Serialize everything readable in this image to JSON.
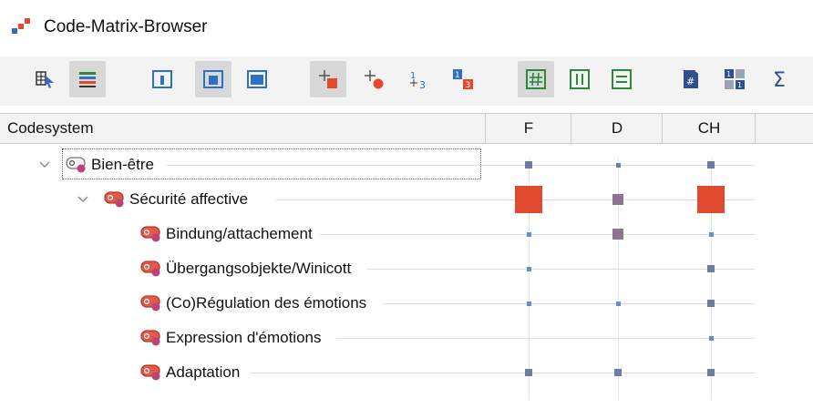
{
  "window": {
    "title": "Code-Matrix-Browser"
  },
  "toolbar": {
    "buttons": [
      {
        "icon": "select-matrix-icon",
        "active": false
      },
      {
        "icon": "colored-bars-icon",
        "active": true
      },
      {
        "icon": "layout-small-icon",
        "active": false
      },
      {
        "icon": "layout-medium-icon",
        "active": true
      },
      {
        "icon": "layout-large-icon",
        "active": false
      },
      {
        "icon": "symbol-square-icon",
        "active": true
      },
      {
        "icon": "symbol-circle-icon",
        "active": false
      },
      {
        "icon": "numbers-icon",
        "active": false
      },
      {
        "icon": "numbers-colored-icon",
        "active": false
      },
      {
        "icon": "grid-hash-icon",
        "active": true
      },
      {
        "icon": "columns-icon",
        "active": false
      },
      {
        "icon": "rows-icon",
        "active": false
      },
      {
        "icon": "document-hash-icon",
        "active": false
      },
      {
        "icon": "stats-icon",
        "active": false
      },
      {
        "icon": "sigma-icon",
        "active": false
      }
    ]
  },
  "table": {
    "header": {
      "codesystem": "Codesystem",
      "columns": [
        "F",
        "D",
        "CH"
      ]
    },
    "rows": [
      {
        "label": "Bien-être",
        "level": 0,
        "expanded": true,
        "focused": true,
        "cells": [
          {
            "size": "small",
            "color": "#6b7fa6"
          },
          {
            "size": "tiny",
            "color": "#6b7fa6"
          },
          {
            "size": "small",
            "color": "#6b7fa6"
          }
        ]
      },
      {
        "label": "Sécurité affective",
        "level": 1,
        "expanded": true,
        "focused": false,
        "cells": [
          {
            "size": "large",
            "color": "#e04a2f"
          },
          {
            "size": "medium",
            "color": "#8e7391"
          },
          {
            "size": "large",
            "color": "#e04a2f"
          }
        ]
      },
      {
        "label": "Bindung/attachement",
        "level": 2,
        "expanded": null,
        "focused": false,
        "cells": [
          {
            "size": "tiny",
            "color": "#5b8fd4"
          },
          {
            "size": "medium",
            "color": "#8e7391"
          },
          {
            "size": "tiny",
            "color": "#5b8fd4"
          }
        ]
      },
      {
        "label": "Übergangsobjekte/Winicott",
        "level": 2,
        "expanded": null,
        "focused": false,
        "cells": [
          {
            "size": "tiny",
            "color": "#5b8fd4"
          },
          null,
          {
            "size": "small",
            "color": "#6b7fa6"
          }
        ]
      },
      {
        "label": "(Co)Régulation des émotions",
        "level": 2,
        "expanded": null,
        "focused": false,
        "cells": [
          {
            "size": "tiny",
            "color": "#5b8fd4"
          },
          {
            "size": "tiny",
            "color": "#5b8fd4"
          },
          {
            "size": "small",
            "color": "#6b7fa6"
          }
        ]
      },
      {
        "label": "Expression d'émotions",
        "level": 2,
        "expanded": null,
        "focused": false,
        "cells": [
          null,
          null,
          {
            "size": "tiny",
            "color": "#5b8fd4"
          }
        ]
      },
      {
        "label": "Adaptation",
        "level": 2,
        "expanded": null,
        "focused": false,
        "cells": [
          {
            "size": "small",
            "color": "#6b7fa6"
          },
          {
            "size": "small",
            "color": "#6b7fa6"
          },
          {
            "size": "small",
            "color": "#6b7fa6"
          }
        ]
      }
    ]
  },
  "colors": {
    "accent_red": "#e04a2f",
    "accent_blue": "#2f6fc4",
    "code_pink": "#c0407a"
  }
}
